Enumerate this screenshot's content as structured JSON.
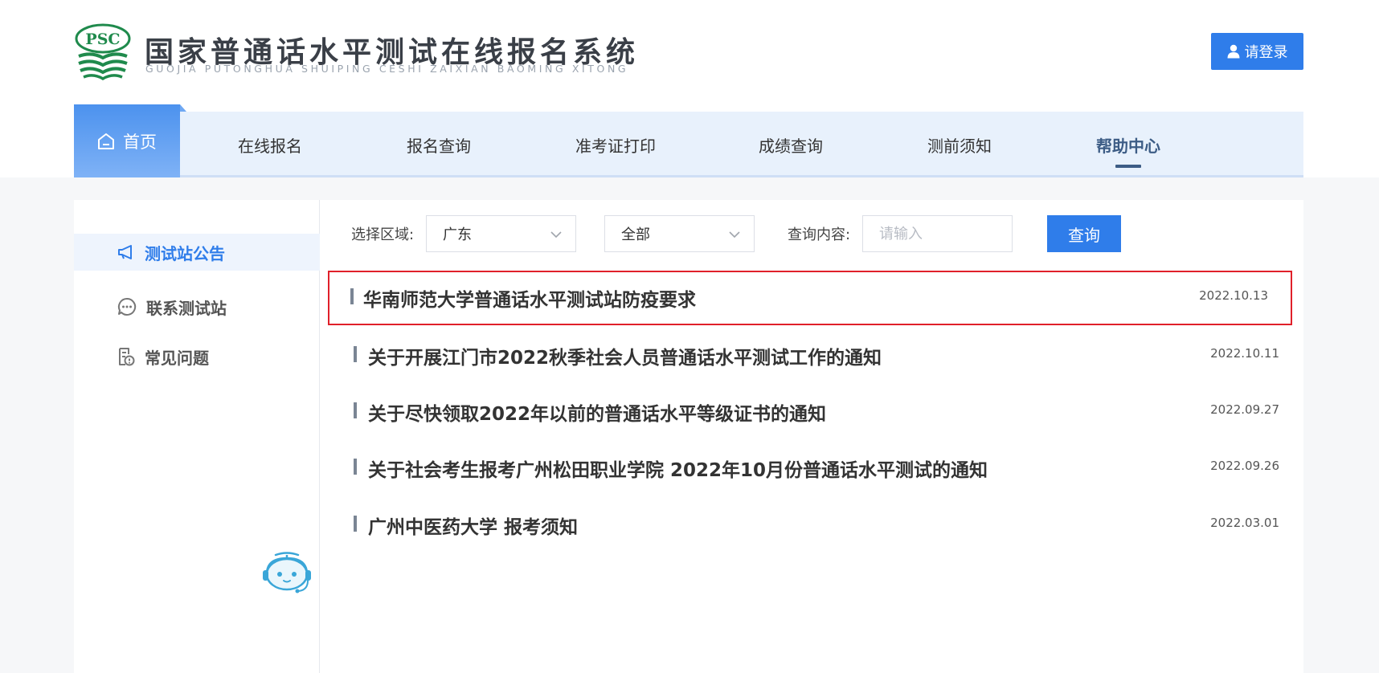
{
  "header": {
    "logo_text": "PSC",
    "title": "国家普通话水平测试在线报名系统",
    "subtitle": "GUOJIA PUTONGHUA SHUIPING CESHI ZAIXIAN BAOMING XITONG",
    "login_label": "请登录"
  },
  "nav": {
    "items": [
      {
        "label": "首页"
      },
      {
        "label": "在线报名"
      },
      {
        "label": "报名查询"
      },
      {
        "label": "准考证打印"
      },
      {
        "label": "成绩查询"
      },
      {
        "label": "测前须知"
      },
      {
        "label": "帮助中心"
      }
    ],
    "active": "帮助中心"
  },
  "sidebar": {
    "items": [
      {
        "label": "测试站公告",
        "icon": "megaphone-icon"
      },
      {
        "label": "联系测试站",
        "icon": "chat-icon"
      },
      {
        "label": "常见问题",
        "icon": "document-question-icon"
      }
    ],
    "active": "测试站公告"
  },
  "filters": {
    "region_label": "选择区域:",
    "region_value": "广东",
    "category_value": "全部",
    "query_label": "查询内容:",
    "query_placeholder": "请输入",
    "query_button": "查询"
  },
  "notices": [
    {
      "title": "华南师范大学普通话水平测试站防疫要求",
      "date": "2022.10.13",
      "highlighted": true
    },
    {
      "title": "关于开展江门市2022秋季社会人员普通话水平测试工作的通知",
      "date": "2022.10.11"
    },
    {
      "title": "关于尽快领取2022年以前的普通话水平等级证书的通知",
      "date": "2022.09.27"
    },
    {
      "title": "关于社会考生报考广州松田职业学院 2022年10月份普通话水平测试的通知",
      "date": "2022.09.26"
    },
    {
      "title": "广州中医药大学 报考须知",
      "date": "2022.03.01"
    }
  ],
  "colors": {
    "primary": "#2f7dea",
    "nav_bg": "#e8f1fc",
    "highlight_border": "#e0202a",
    "logo_green": "#1f8a4c"
  }
}
